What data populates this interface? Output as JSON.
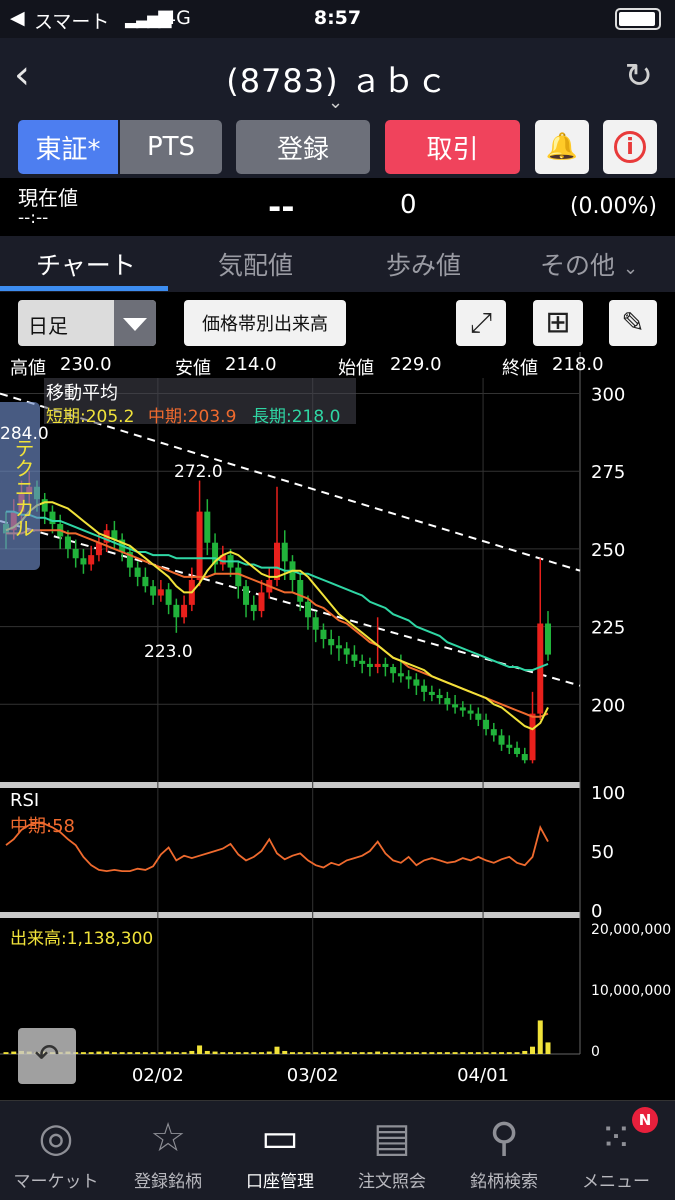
{
  "status": {
    "carrier": "スマート",
    "network": "4G",
    "time": "8:57"
  },
  "nav": {
    "title": "(8783) ａｂｃ"
  },
  "buttons": {
    "tosho": "東証*",
    "pts": "PTS",
    "register": "登録",
    "trade": "取引"
  },
  "quote": {
    "label": "現在値",
    "time": "--:--",
    "price": "--",
    "change": "0",
    "pct": "(0.00%)"
  },
  "tabs": [
    "チャート",
    "気配値",
    "歩み値",
    "その他"
  ],
  "toolbar": {
    "period": "日足",
    "volume_profile": "価格帯別出来高"
  },
  "ohlc": {
    "high_label": "高値",
    "high": "230.0",
    "low_label": "安値",
    "low": "214.0",
    "open_label": "始値",
    "open": "229.0",
    "close_label": "終値",
    "close": "218.0"
  },
  "ma": {
    "title": "移動平均",
    "short": "短期:205.2",
    "mid": "中期:203.9",
    "long": "長期:218.0"
  },
  "technical_tab": "テクニカル",
  "annotations": {
    "a284": "284.0",
    "a272": "272.0",
    "a223": "223.0"
  },
  "rsi": {
    "title": "RSI",
    "mid": "中期:58"
  },
  "volume": {
    "label": "出来高:1,138,300"
  },
  "footer": [
    "マーケット",
    "登録銘柄",
    "口座管理",
    "注文照会",
    "銘柄検索",
    "メニュー"
  ],
  "badge": "N",
  "colors": {
    "up": "#e8201c",
    "down": "#21b33b",
    "short": "#f0e23a",
    "mid": "#ef6a2e",
    "long": "#2fd6a4",
    "accent": "#3d8df0",
    "trade": "#f0435c"
  },
  "chart_data": {
    "type": "line",
    "price_ylim": [
      175,
      305
    ],
    "price_ticks": [
      300,
      275,
      250,
      225,
      200
    ],
    "rsi_ticks": [
      100,
      50,
      0
    ],
    "volume_ticks": [
      "20,000,000",
      "10,000,000",
      "0"
    ],
    "date_labels": [
      "02/02",
      "03/02",
      "04/01"
    ],
    "candles": [
      [
        258,
        255,
        262,
        250
      ],
      [
        256,
        262,
        266,
        253
      ],
      [
        262,
        268,
        272,
        258
      ],
      [
        268,
        270,
        275,
        264
      ],
      [
        270,
        266,
        272,
        262
      ],
      [
        266,
        262,
        268,
        258
      ],
      [
        262,
        258,
        264,
        255
      ],
      [
        258,
        254,
        261,
        250
      ],
      [
        254,
        250,
        256,
        247
      ],
      [
        250,
        247,
        253,
        244
      ],
      [
        247,
        245,
        250,
        242
      ],
      [
        245,
        248,
        251,
        243
      ],
      [
        248,
        252,
        255,
        246
      ],
      [
        252,
        256,
        258,
        249
      ],
      [
        256,
        253,
        259,
        250
      ],
      [
        253,
        249,
        255,
        246
      ],
      [
        249,
        244,
        251,
        241
      ],
      [
        244,
        241,
        246,
        238
      ],
      [
        241,
        238,
        244,
        236
      ],
      [
        238,
        235,
        240,
        232
      ],
      [
        235,
        237,
        240,
        233
      ],
      [
        237,
        232,
        239,
        229
      ],
      [
        232,
        228,
        234,
        223
      ],
      [
        228,
        232,
        235,
        226
      ],
      [
        232,
        240,
        244,
        230
      ],
      [
        240,
        262,
        272,
        238
      ],
      [
        262,
        252,
        266,
        248
      ],
      [
        252,
        245,
        255,
        242
      ],
      [
        245,
        248,
        251,
        243
      ],
      [
        248,
        244,
        250,
        241
      ],
      [
        244,
        238,
        246,
        234
      ],
      [
        238,
        232,
        240,
        228
      ],
      [
        232,
        230,
        235,
        227
      ],
      [
        230,
        236,
        240,
        228
      ],
      [
        236,
        240,
        244,
        234
      ],
      [
        240,
        252,
        270,
        238
      ],
      [
        252,
        246,
        256,
        240
      ],
      [
        246,
        240,
        248,
        236
      ],
      [
        240,
        233,
        242,
        230
      ],
      [
        233,
        228,
        235,
        224
      ],
      [
        228,
        224,
        230,
        220
      ],
      [
        224,
        221,
        226,
        218
      ],
      [
        221,
        219,
        224,
        216
      ],
      [
        219,
        218,
        222,
        214
      ],
      [
        218,
        216,
        220,
        213
      ],
      [
        216,
        214,
        219,
        212
      ],
      [
        214,
        213,
        216,
        210
      ],
      [
        213,
        212,
        215,
        209
      ],
      [
        212,
        213,
        228,
        210
      ],
      [
        213,
        212,
        215,
        209
      ],
      [
        212,
        210,
        213,
        207
      ],
      [
        210,
        209,
        216,
        207
      ],
      [
        209,
        208,
        211,
        205
      ],
      [
        208,
        206,
        210,
        203
      ],
      [
        206,
        204,
        208,
        201
      ],
      [
        204,
        203,
        206,
        201
      ],
      [
        203,
        202,
        205,
        200
      ],
      [
        202,
        200,
        204,
        198
      ],
      [
        200,
        199,
        203,
        197
      ],
      [
        199,
        198,
        201,
        196
      ],
      [
        198,
        197,
        200,
        195
      ],
      [
        197,
        195,
        199,
        193
      ],
      [
        195,
        192,
        197,
        190
      ],
      [
        192,
        190,
        194,
        188
      ],
      [
        190,
        187,
        192,
        185
      ],
      [
        187,
        186,
        190,
        184
      ],
      [
        186,
        184,
        188,
        183
      ],
      [
        184,
        182,
        186,
        181
      ],
      [
        182,
        197,
        204,
        181
      ],
      [
        197,
        226,
        247,
        195
      ],
      [
        226,
        216,
        230,
        214
      ]
    ],
    "ma_short": [
      256,
      257,
      259,
      262,
      264,
      265,
      265,
      264,
      263,
      261,
      259,
      257,
      255,
      254,
      253,
      252,
      251,
      249,
      247,
      245,
      243,
      241,
      238,
      236,
      236,
      239,
      243,
      246,
      248,
      249,
      248,
      246,
      244,
      242,
      241,
      241,
      242,
      243,
      243,
      241,
      238,
      235,
      232,
      229,
      227,
      225,
      223,
      221,
      219,
      217,
      215,
      214,
      213,
      212,
      211,
      209,
      208,
      207,
      206,
      205,
      204,
      203,
      202,
      200,
      199,
      197,
      195,
      193,
      192,
      194,
      199
    ],
    "ma_mid": [
      255,
      255,
      255,
      256,
      256,
      256,
      256,
      256,
      255,
      255,
      254,
      253,
      252,
      251,
      250,
      249,
      248,
      247,
      246,
      245,
      244,
      243,
      242,
      241,
      241,
      241,
      241,
      242,
      242,
      242,
      242,
      241,
      240,
      239,
      238,
      237,
      236,
      236,
      235,
      234,
      232,
      231,
      229,
      227,
      226,
      224,
      222,
      220,
      219,
      217,
      215,
      214,
      212,
      211,
      210,
      209,
      208,
      207,
      206,
      205,
      204,
      203,
      202,
      201,
      200,
      199,
      198,
      197,
      196,
      196,
      197
    ],
    "ma_long": [
      262,
      262,
      261,
      261,
      260,
      260,
      259,
      259,
      258,
      257,
      256,
      255,
      254,
      253,
      252,
      251,
      250,
      249,
      249,
      248,
      248,
      248,
      247,
      247,
      247,
      247,
      247,
      247,
      246,
      246,
      246,
      245,
      245,
      244,
      244,
      244,
      243,
      243,
      242,
      242,
      241,
      240,
      239,
      238,
      237,
      236,
      235,
      233,
      232,
      231,
      229,
      228,
      227,
      225,
      224,
      223,
      222,
      220,
      219,
      218,
      217,
      216,
      215,
      214,
      213,
      212,
      212,
      211,
      211,
      212,
      213
    ],
    "rsi": [
      55,
      60,
      68,
      72,
      74,
      73,
      70,
      66,
      60,
      55,
      45,
      38,
      34,
      33,
      34,
      33,
      33,
      35,
      34,
      37,
      47,
      53,
      42,
      46,
      44,
      46,
      48,
      50,
      52,
      56,
      47,
      42,
      45,
      50,
      60,
      48,
      43,
      46,
      48,
      42,
      38,
      36,
      40,
      38,
      42,
      44,
      46,
      50,
      58,
      48,
      42,
      40,
      45,
      38,
      42,
      44,
      42,
      40,
      41,
      44,
      42,
      45,
      42,
      40,
      43,
      45,
      40,
      38,
      45,
      70,
      58
    ],
    "volume": [
      0.3,
      0.4,
      0.5,
      0.4,
      0.3,
      0.4,
      0.3,
      0.3,
      0.4,
      0.3,
      0.3,
      0.3,
      0.4,
      0.4,
      0.3,
      0.3,
      0.3,
      0.3,
      0.3,
      0.3,
      0.3,
      0.4,
      0.3,
      0.3,
      0.5,
      1.4,
      0.5,
      0.4,
      0.3,
      0.3,
      0.3,
      0.3,
      0.3,
      0.3,
      0.4,
      1.2,
      0.5,
      0.3,
      0.3,
      0.3,
      0.3,
      0.3,
      0.3,
      0.4,
      0.3,
      0.3,
      0.3,
      0.3,
      0.4,
      0.3,
      0.3,
      0.3,
      0.3,
      0.3,
      0.3,
      0.3,
      0.3,
      0.3,
      0.3,
      0.3,
      0.3,
      0.3,
      0.3,
      0.3,
      0.3,
      0.3,
      0.3,
      0.5,
      1.2,
      5.5,
      1.9
    ]
  }
}
